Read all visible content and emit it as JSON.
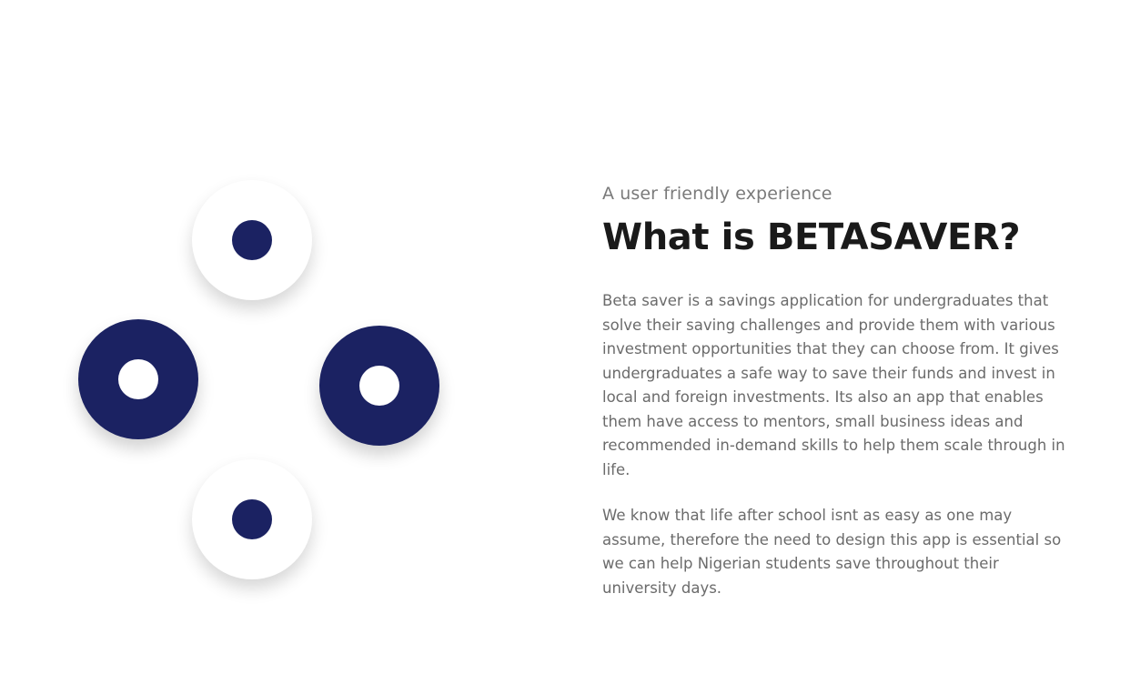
{
  "illustration": {
    "circles": [
      {
        "name": "top-light-circle",
        "style": "light"
      },
      {
        "name": "left-dark-ring",
        "style": "dark"
      },
      {
        "name": "right-dark-ring",
        "style": "dark"
      },
      {
        "name": "bottom-light-circle",
        "style": "light"
      }
    ],
    "colors": {
      "navy": "#1b2262",
      "white": "#ffffff"
    }
  },
  "content": {
    "eyebrow": "A user friendly experience",
    "title": "What is BETASAVER?",
    "paragraph_1": "Beta saver is a savings application for undergraduates that solve their saving challenges and provide them with various investment opportunities that they can choose from. It gives undergraduates a safe way to save their funds and invest in local and foreign investments. Its also an app that enables them have access to mentors, small business ideas and recommended in-demand skills to help them scale through in life.",
    "paragraph_2": "We know that life after school isnt as easy as one may assume, therefore the need to design this app is essential so we can help Nigerian students save throughout their university days."
  }
}
